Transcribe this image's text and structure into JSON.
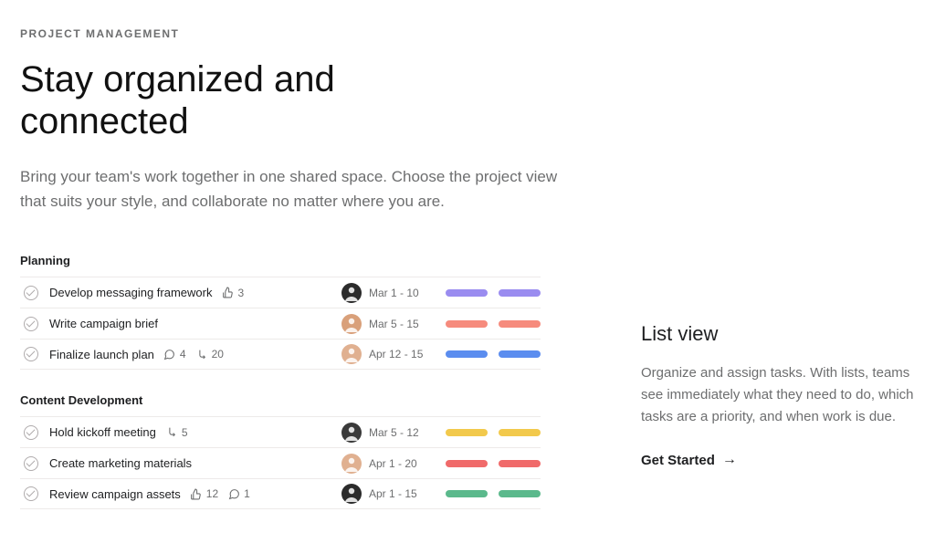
{
  "eyebrow": "PROJECT MANAGEMENT",
  "headline": "Stay organized and connected",
  "subcopy": "Bring your team's work together in one shared space. Choose the project view that suits your style, and collaborate no matter where you are.",
  "sections": [
    {
      "title": "Planning",
      "tasks": [
        {
          "name": "Develop messaging framework",
          "likes": "3",
          "comments": null,
          "subtasks": null,
          "avatar_bg": "#2b2b2b",
          "date": "Mar 1 - 10",
          "pill_color": "#9a8cf0"
        },
        {
          "name": "Write campaign brief",
          "likes": null,
          "comments": null,
          "subtasks": null,
          "avatar_bg": "#d9a07a",
          "date": "Mar 5 - 15",
          "pill_color": "#f68b7d"
        },
        {
          "name": "Finalize launch plan",
          "likes": null,
          "comments": "4",
          "subtasks": "20",
          "avatar_bg": "#e0b090",
          "date": "Apr 12 - 15",
          "pill_color": "#5b8def"
        }
      ]
    },
    {
      "title": "Content Development",
      "tasks": [
        {
          "name": "Hold kickoff meeting",
          "likes": null,
          "comments": null,
          "subtasks": "5",
          "avatar_bg": "#3a3a3a",
          "date": "Mar 5 - 12",
          "pill_color": "#f2c94c"
        },
        {
          "name": "Create marketing materials",
          "likes": null,
          "comments": null,
          "subtasks": null,
          "avatar_bg": "#e0b090",
          "date": "Apr 1 - 20",
          "pill_color": "#f06a6a"
        },
        {
          "name": "Review campaign assets",
          "likes": "12",
          "comments": "1",
          "subtasks": null,
          "avatar_bg": "#2b2b2b",
          "date": "Apr 1 - 15",
          "pill_color": "#5bb98c"
        }
      ]
    }
  ],
  "right": {
    "title": "List view",
    "body": "Organize and assign tasks. With lists, teams see immediately what they need to do, which tasks are a priority, and when work is due.",
    "cta": "Get Started"
  }
}
